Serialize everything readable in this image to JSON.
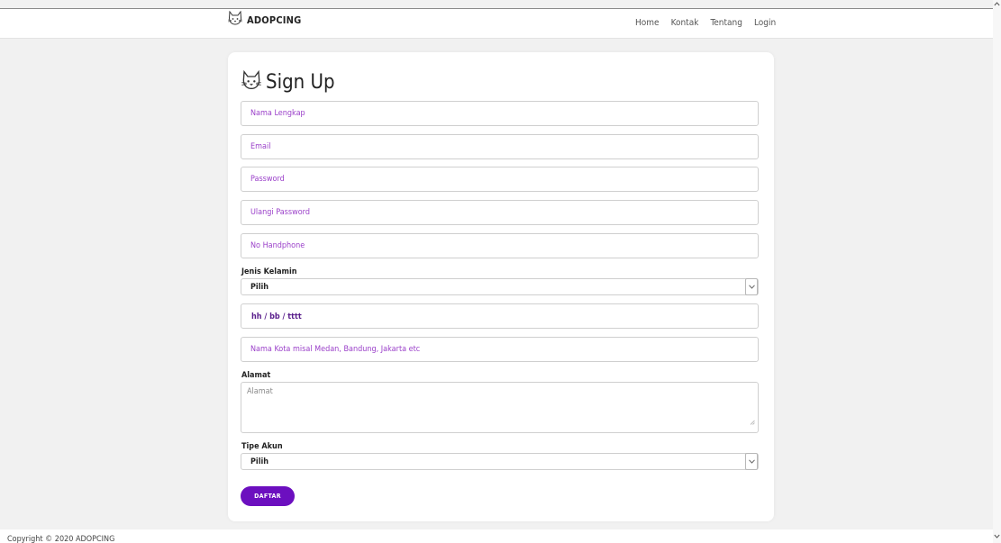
{
  "navbar": {
    "brand": "ADOPCING",
    "links": [
      "Home",
      "Kontak",
      "Tentang",
      "Login"
    ]
  },
  "form": {
    "title": "Sign Up",
    "fields": {
      "nama": "Nama Lengkap",
      "email": "Email",
      "password": "Password",
      "ulangi_password": "Ulangi Password",
      "handphone": "No Handphone",
      "kota": "Nama Kota misal Medan, Bandung, Jakarta etc"
    },
    "jenis_kelamin": {
      "label": "Jenis Kelamin",
      "value": "Pilih"
    },
    "tanggal": "hh / bb / tttt",
    "alamat": {
      "label": "Alamat",
      "placeholder": "Alamat"
    },
    "tipe_akun": {
      "label": "Tipe Akun",
      "value": "Pilih"
    },
    "submit": "DAFTAR"
  },
  "footer": {
    "text": "Copyright © 2020 ADOPCING"
  },
  "colors": {
    "accent": "#6c0fbf",
    "placeholder": "#9a3fc9",
    "background": "#f1f1f1"
  },
  "icons": [
    "cat-logo-icon",
    "chevron-down-icon",
    "resize-handle-icon",
    "scroll-up-icon",
    "scroll-down-icon"
  ]
}
